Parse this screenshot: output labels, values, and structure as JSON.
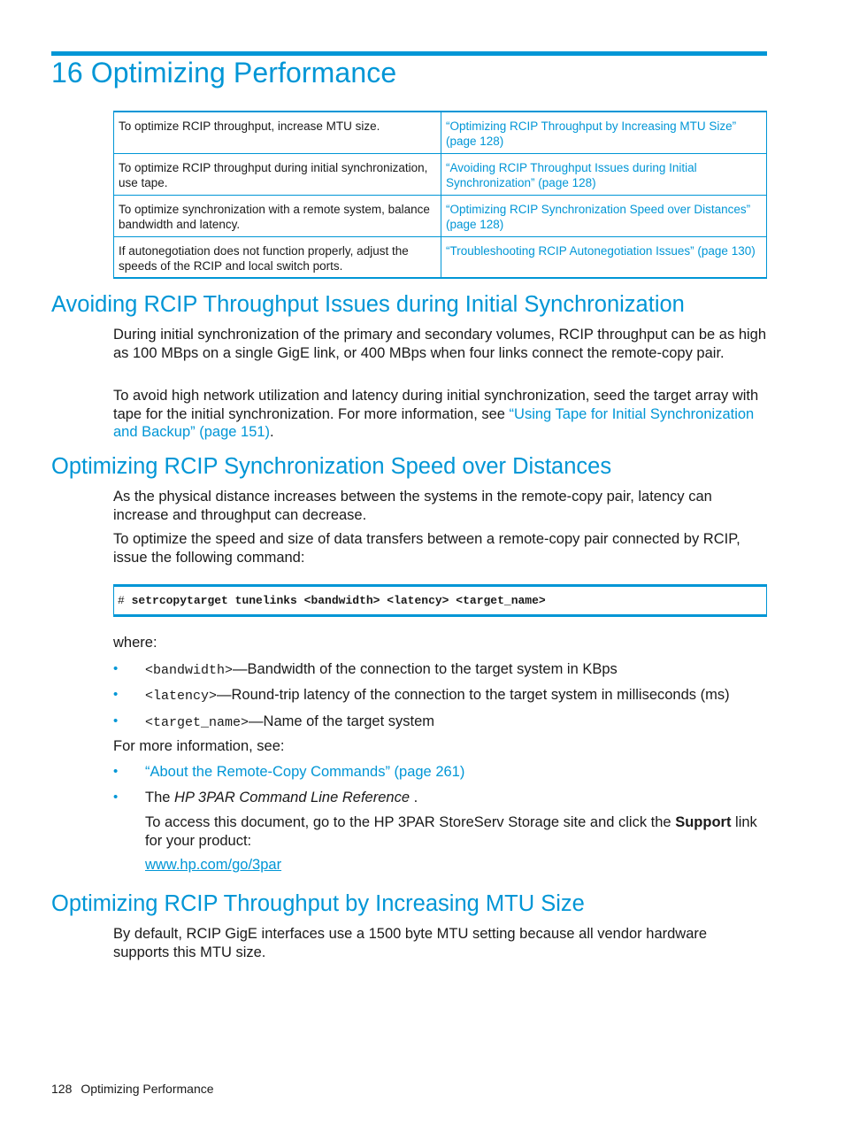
{
  "chapter": {
    "number": "16",
    "title": "16 Optimizing Performance"
  },
  "overview_table": {
    "rows": [
      {
        "task": "To optimize RCIP throughput, increase MTU size.",
        "reference": "“Optimizing RCIP Throughput by Increasing MTU Size” (page 128)"
      },
      {
        "task": "To optimize RCIP throughput during initial synchronization, use tape.",
        "reference": "“Avoiding RCIP Throughput Issues during Initial Synchronization” (page 128)"
      },
      {
        "task": "To optimize synchronization with a remote system, balance bandwidth and latency.",
        "reference": "“Optimizing RCIP Synchronization Speed over Distances” (page 128)"
      },
      {
        "task": "If autonegotiation does not function properly, adjust the speeds of the RCIP and local switch ports.",
        "reference": "“Troubleshooting RCIP Autonegotiation Issues” (page 130)"
      }
    ]
  },
  "section_initial_sync": {
    "heading": "Avoiding RCIP Throughput Issues during Initial Synchronization",
    "para1": "During initial synchronization of the primary and secondary volumes, RCIP throughput can be as high as 100 MBps on a single GigE link, or 400 MBps when four links connect the remote-copy pair.",
    "para2_before": "To avoid high network utilization and latency during initial synchronization, seed the target array with tape for the initial synchronization. For more information, see ",
    "para2_link": "“Using Tape for Initial Synchronization and Backup” (page 151)",
    "para2_after": "."
  },
  "section_distances": {
    "heading": "Optimizing RCIP Synchronization Speed over Distances",
    "para1": "As the physical distance increases between the systems in the remote-copy pair, latency can increase and throughput can decrease.",
    "para2": "To optimize the speed and size of data transfers between a remote-copy pair connected by RCIP, issue the following command:",
    "code_prompt": "#",
    "code_command": "setrcopytarget tunelinks <bandwidth> <latency> <target_name>",
    "where_label": "where:",
    "params": [
      {
        "name": "<bandwidth>",
        "desc": "—Bandwidth of the connection to the target system in KBps"
      },
      {
        "name": "<latency>",
        "desc": "—Round-trip latency of the connection to the target system in milliseconds (ms)"
      },
      {
        "name": "<target_name>",
        "desc": "—Name of the target system"
      }
    ],
    "more_info_label": "For more information, see:",
    "more_info_link": "“About the Remote-Copy Commands” (page 261)",
    "reference_prefix": "The ",
    "reference_title": "HP 3PAR Command Line Reference",
    "reference_suffix": " .",
    "access_before": "To access this document, go to the HP 3PAR StoreServ Storage site and click the ",
    "access_bold": "Support",
    "access_after": " link for your product:",
    "url": "www.hp.com/go/3par"
  },
  "section_mtu": {
    "heading": "Optimizing RCIP Throughput by Increasing MTU Size",
    "para1": "By default, RCIP GigE interfaces use a 1500 byte MTU setting because all vendor hardware supports this MTU size."
  },
  "footer": {
    "page_number": "128",
    "section_title": "Optimizing Performance"
  },
  "colors": {
    "accent": "#0096d6",
    "text": "#1a1a1a"
  }
}
